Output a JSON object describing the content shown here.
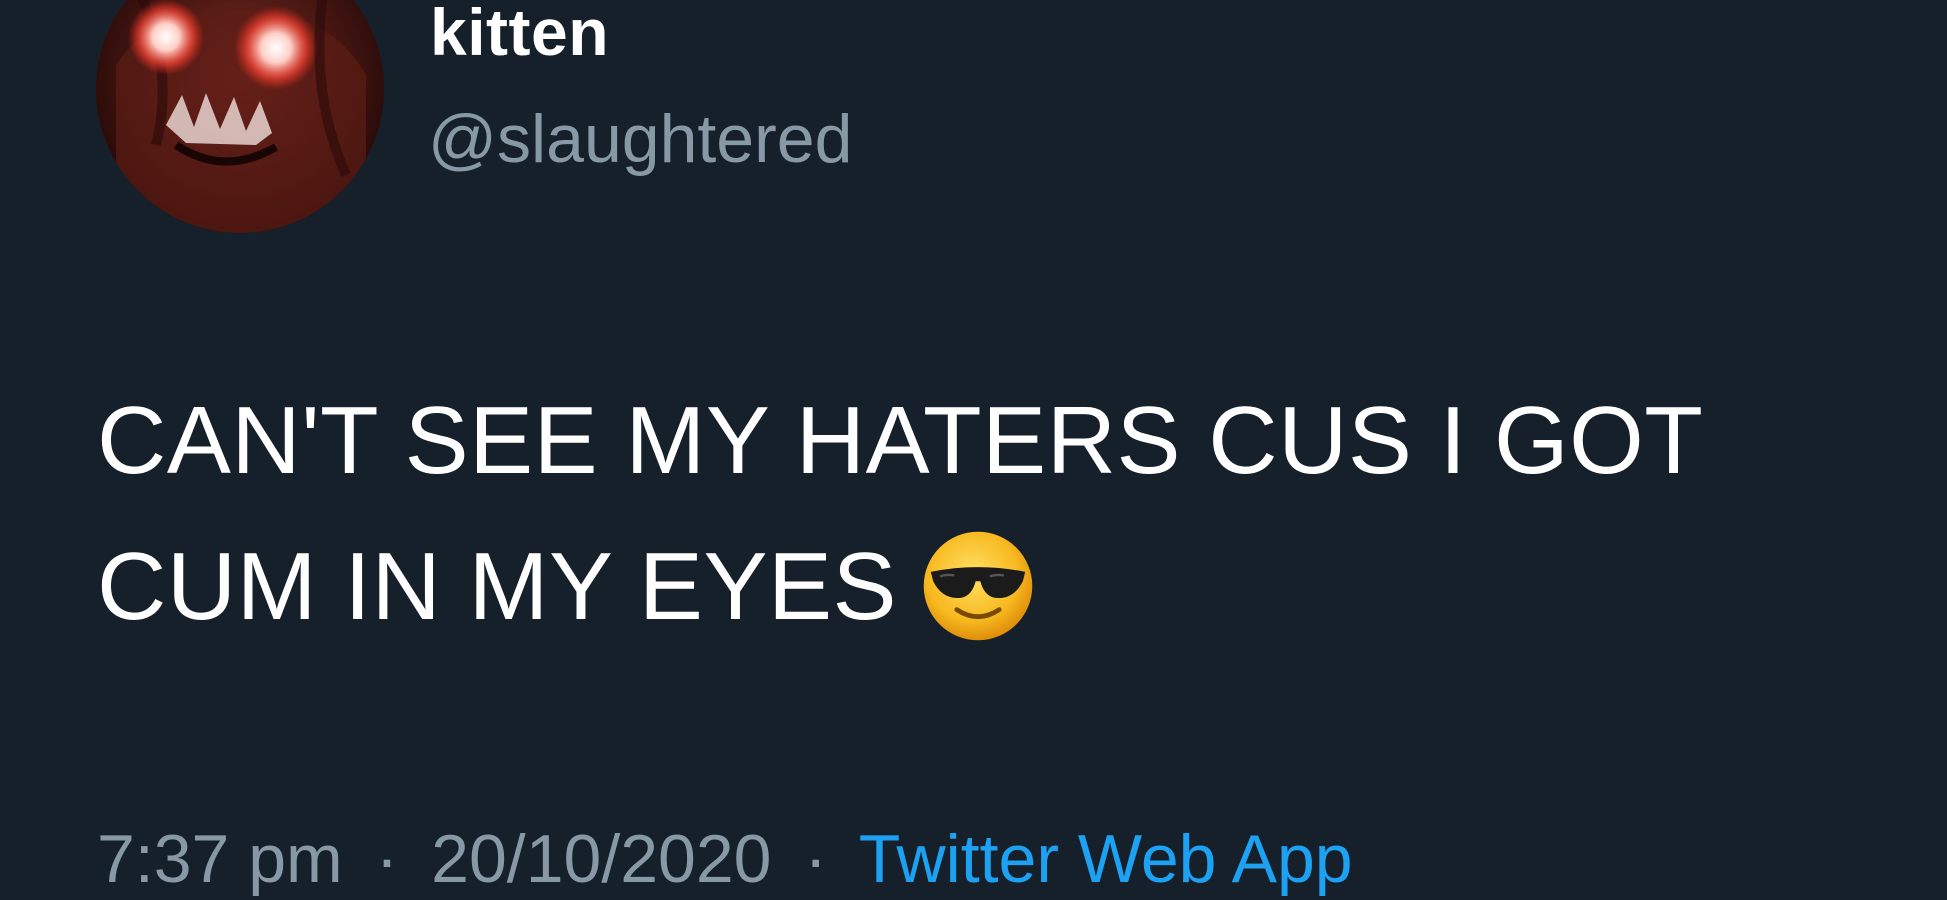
{
  "author": {
    "display_name": "kitten",
    "handle": "@slaughtered",
    "avatar_icon": "creature-avatar-red-glowing-eyes"
  },
  "tweet": {
    "line1": "CAN'T SEE MY HATERS CUS I GOT",
    "line2": "CUM IN MY EYES",
    "emoji_icon": "smiling-face-with-sunglasses-emoji"
  },
  "meta": {
    "time": "7:37 pm",
    "separator": "·",
    "date": "20/10/2020",
    "source": "Twitter Web App"
  },
  "colors": {
    "background": "#15202b",
    "primary_text": "#ffffff",
    "secondary_text": "#8899a6",
    "link": "#1da1f2"
  }
}
